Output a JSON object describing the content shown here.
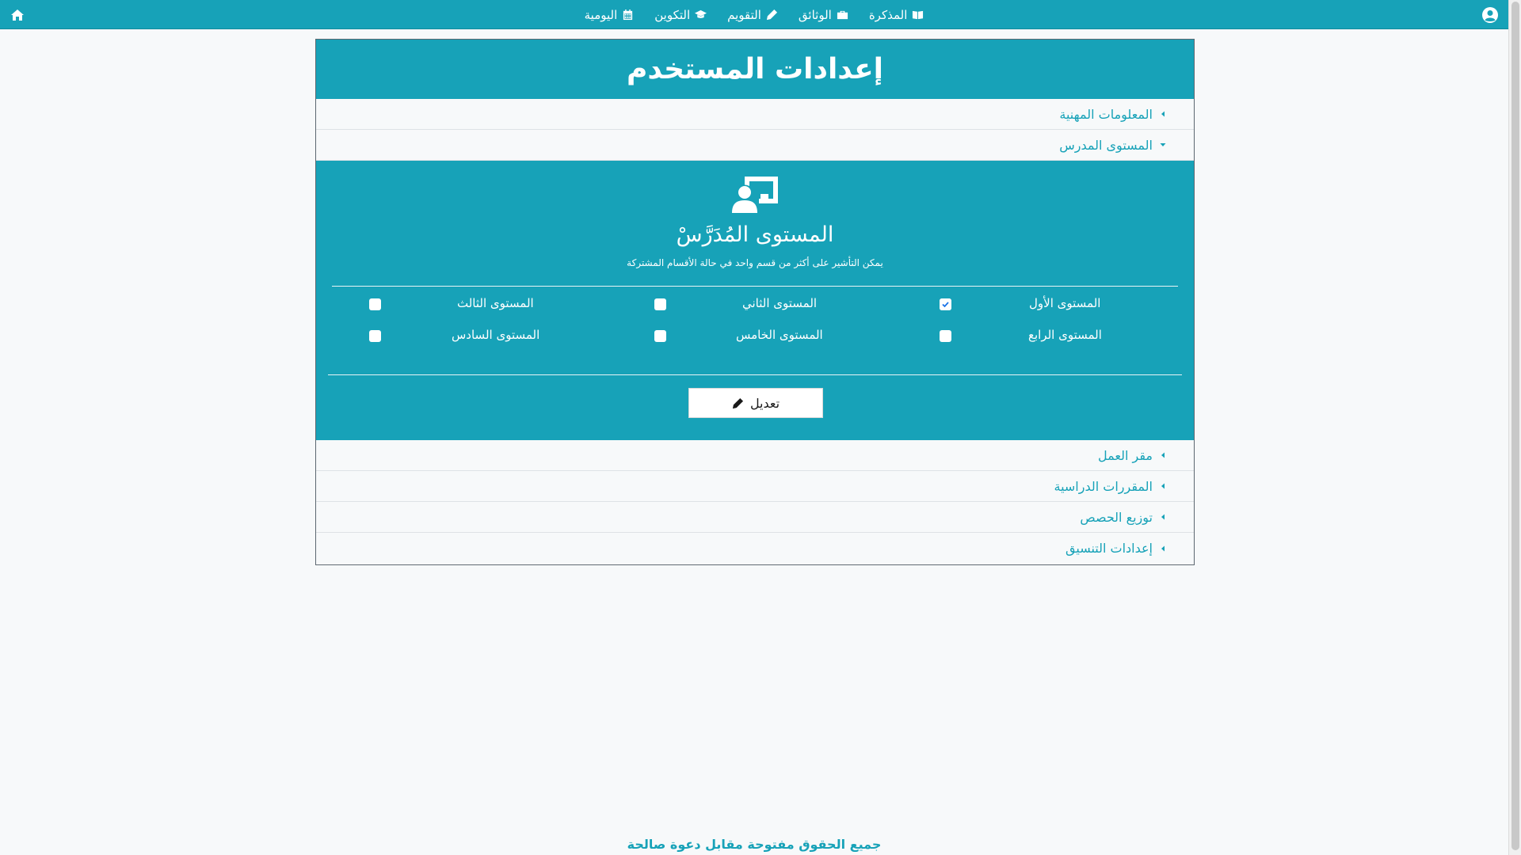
{
  "nav": {
    "items": [
      {
        "label": "المذكرة",
        "icon": "book-open-icon"
      },
      {
        "label": "الوثائق",
        "icon": "briefcase-icon"
      },
      {
        "label": "التقويم",
        "icon": "pencil-icon"
      },
      {
        "label": "التكوين",
        "icon": "graduation-cap-icon"
      },
      {
        "label": "اليومية",
        "icon": "calendar-icon"
      }
    ],
    "home_icon": "home-icon",
    "user_icon": "user-circle-icon"
  },
  "card": {
    "title": "إعدادات المستخدم",
    "sections_before": [
      {
        "label": "المعلومات المهنية",
        "expanded": false
      },
      {
        "label": "المستوى المدرس",
        "expanded": true
      }
    ],
    "panel": {
      "icon": "chalkboard-teacher-icon",
      "title": "المستوى المُدَرَّسْ",
      "subtitle": "يمكن التأشير على أكثر من قسم واحد في حالة الأقسام المشتركة",
      "levels": [
        {
          "label": "المستوى الأول",
          "checked": true
        },
        {
          "label": "المستوى الثاني",
          "checked": false
        },
        {
          "label": "المستوى الثالث",
          "checked": false
        },
        {
          "label": "المستوى الرابع",
          "checked": false
        },
        {
          "label": "المستوى الخامس",
          "checked": false
        },
        {
          "label": "المستوى السادس",
          "checked": false
        }
      ],
      "edit_label": "تعديل"
    },
    "sections_after": [
      {
        "label": "مقر العمل"
      },
      {
        "label": "المقررات الدراسية"
      },
      {
        "label": "توزيع الحصص"
      },
      {
        "label": "إعدادات التنسيق"
      }
    ]
  },
  "footer": {
    "text": "جميع الحقوق مفتوحة مقابل دعوة صالحة"
  },
  "colors": {
    "primary": "#17a2b8",
    "background": "#f7f9fa",
    "checkbox_checked": "#1a73e8"
  }
}
